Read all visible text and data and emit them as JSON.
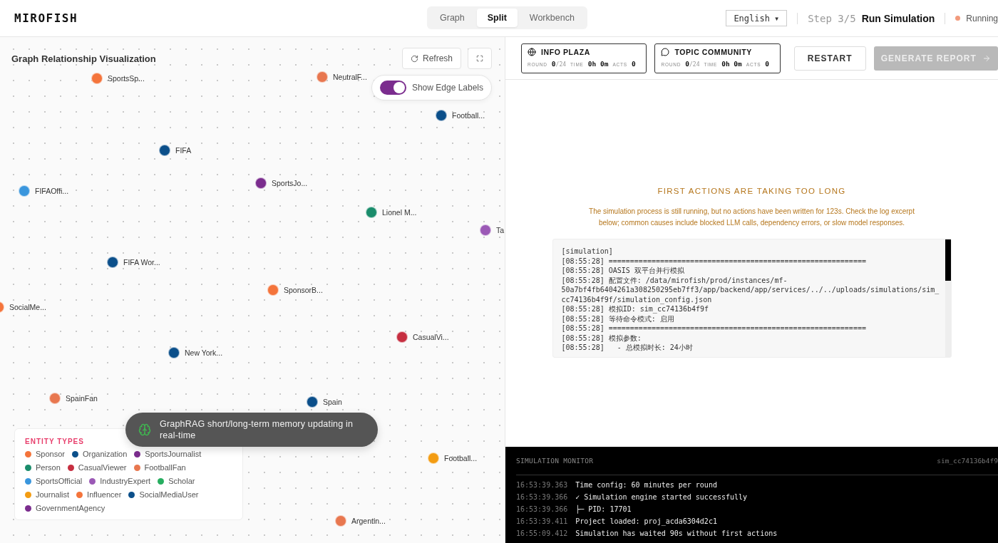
{
  "app": {
    "logo": "MIROFISH"
  },
  "view_modes": [
    {
      "label": "Graph",
      "selected": false
    },
    {
      "label": "Split",
      "selected": true
    },
    {
      "label": "Workbench",
      "selected": false
    }
  ],
  "language": {
    "value": "English",
    "caret": "▾"
  },
  "step": {
    "number": "Step 3/5",
    "title": "Run Simulation"
  },
  "status": {
    "label": "Running"
  },
  "graph": {
    "title": "Graph Relationship Visualization",
    "refresh": "Refresh",
    "edge_labels": {
      "label": "Show Edge Labels",
      "on": true
    },
    "nodes": [
      {
        "label": "SportsSp...",
        "color": "#f4743b"
      },
      {
        "label": "NeutralF...",
        "color": "#e8774f"
      },
      {
        "label": "Football...",
        "color": "#0b4f8a"
      },
      {
        "label": "FIFA",
        "color": "#0b4f8a"
      },
      {
        "label": "SportsJo...",
        "color": "#7b2d8e"
      },
      {
        "label": "FIFAOffi...",
        "color": "#3a96dd"
      },
      {
        "label": "Lionel M...",
        "color": "#1a8c6b"
      },
      {
        "label": "Ta",
        "color": "#9b59b6"
      },
      {
        "label": "FIFA Wor...",
        "color": "#0b4f8a"
      },
      {
        "label": "SponsorB...",
        "color": "#f4743b"
      },
      {
        "label": "SocialMe...",
        "color": "#f4743b"
      },
      {
        "label": "CasualVi...",
        "color": "#c62e40"
      },
      {
        "label": "New York...",
        "color": "#0b4f8a"
      },
      {
        "label": "SpainFan",
        "color": "#e8774f"
      },
      {
        "label": "Spain",
        "color": "#0b4f8a"
      },
      {
        "label": "Football...",
        "color": "#f39c12"
      },
      {
        "label": "Argentin...",
        "color": "#e8774f"
      }
    ],
    "toast": "GraphRAG short/long-term memory updating in real-time",
    "legend": {
      "title": "ENTITY TYPES",
      "items": [
        {
          "label": "Sponsor",
          "color": "#f4743b"
        },
        {
          "label": "Organization",
          "color": "#0b4f8a"
        },
        {
          "label": "SportsJournalist",
          "color": "#7b2d8e"
        },
        {
          "label": "Person",
          "color": "#1a8c6b"
        },
        {
          "label": "CasualViewer",
          "color": "#c62e40"
        },
        {
          "label": "FootballFan",
          "color": "#e8774f"
        },
        {
          "label": "SportsOfficial",
          "color": "#3a96dd"
        },
        {
          "label": "IndustryExpert",
          "color": "#9b59b6"
        },
        {
          "label": "Scholar",
          "color": "#27ae60"
        },
        {
          "label": "Journalist",
          "color": "#f39c12"
        },
        {
          "label": "Influencer",
          "color": "#f4743b"
        },
        {
          "label": "SocialMediaUser",
          "color": "#0b4f8a"
        },
        {
          "label": "GovernmentAgency",
          "color": "#7b2d8e"
        }
      ]
    }
  },
  "platforms": [
    {
      "kind": "globe",
      "name": "INFO PLAZA",
      "round_label": "ROUND",
      "round": "0",
      "round_total": "/24",
      "time_label": "TIME",
      "time": "0h 0m",
      "acts_label": "ACTS",
      "acts": "0"
    },
    {
      "kind": "chat",
      "name": "TOPIC COMMUNITY",
      "round_label": "ROUND",
      "round": "0",
      "round_total": "/24",
      "time_label": "TIME",
      "time": "0h 0m",
      "acts_label": "ACTS",
      "acts": "0"
    }
  ],
  "actions": {
    "restart": "RESTART",
    "generate": {
      "label": "GENERATE REPORT",
      "disabled": true
    }
  },
  "warning": {
    "title": "FIRST ACTIONS ARE TAKING TOO LONG",
    "message": "The simulation process is still running, but no actions have been written for 123s. Check the log excerpt below; common causes include blocked LLM calls, dependency errors, or slow model responses."
  },
  "log": [
    "[simulation]",
    "[08:55:28] ============================================================",
    "[08:55:28] OASIS 双平台并行模拟",
    "[08:55:28] 配置文件: /data/mirofish/prod/instances/mf-50a7bf4fb6404261a308250295eb7ff3/app/backend/app/services/../../uploads/simulations/sim_cc74136b4f9f/simulation_config.json",
    "[08:55:28] 模拟ID: sim_cc74136b4f9f",
    "[08:55:28] 等待命令模式: 启用",
    "[08:55:28] ============================================================",
    "[08:55:28] 模拟参数:",
    "[08:55:28]   - 总模拟时长: 24小时"
  ],
  "monitor": {
    "title": "SIMULATION MONITOR",
    "id": "sim_cc74136b4f9",
    "entries": [
      {
        "time": "16:53:39.363",
        "message": "Time config: 60 minutes per round"
      },
      {
        "time": "16:53:39.366",
        "message": "✓ Simulation engine started successfully"
      },
      {
        "time": "16:53:39.366",
        "message": "├─ PID: 17701"
      },
      {
        "time": "16:53:39.411",
        "message": "Project loaded: proj_acda6304d2c1"
      },
      {
        "time": "16:55:09.412",
        "message": "Simulation has waited 90s without first actions"
      }
    ]
  }
}
